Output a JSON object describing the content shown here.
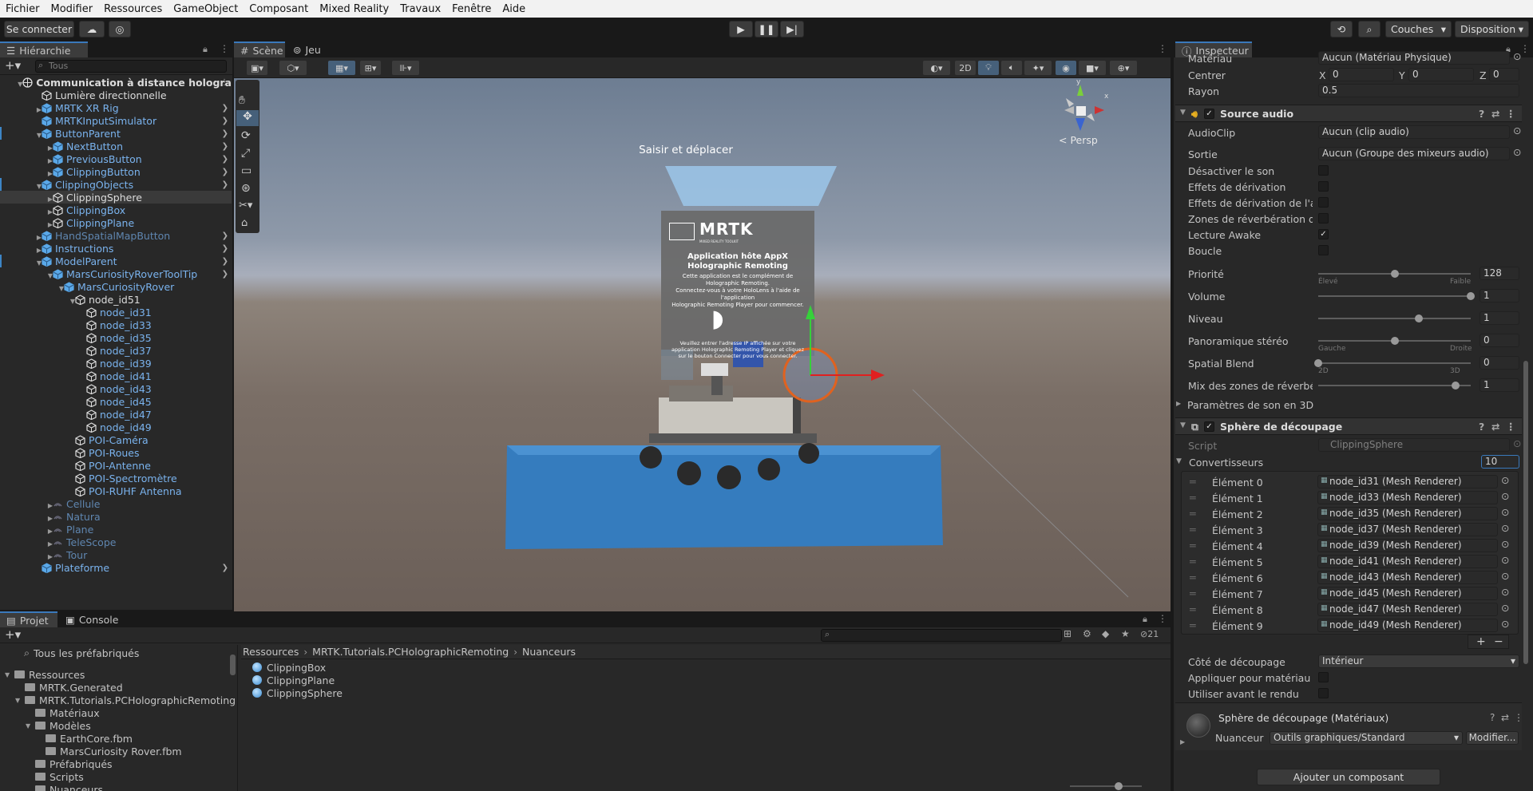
{
  "menu": [
    "Fichier",
    "Modifier",
    "Ressources",
    "GameObject",
    "Composant",
    "Mixed Reality",
    "Travaux",
    "Fenêtre",
    "Aide"
  ],
  "toolbar": {
    "connect": "Se connecter",
    "layers": "Couches",
    "layout": "Disposition"
  },
  "hierarchy": {
    "tab": "Hiérarchie",
    "search_placeholder": "Tous",
    "rows": [
      {
        "label": "Communication à distance hologra",
        "indent": 0,
        "tri": "▼",
        "style": "white",
        "icon": "scene"
      },
      {
        "label": "Lumière directionnelle",
        "indent": 1,
        "tri": "",
        "style": "white",
        "icon": "cube"
      },
      {
        "label": "MRTK XR Rig",
        "indent": 1,
        "tri": "▶",
        "style": "blue",
        "icon": "prefab",
        "chev": true
      },
      {
        "label": "MRTKInputSimulator",
        "indent": 1,
        "tri": "",
        "style": "blue",
        "icon": "prefab",
        "chev": true
      },
      {
        "label": "ButtonParent",
        "indent": 1,
        "tri": "▼",
        "style": "blue",
        "icon": "prefab",
        "chev": true,
        "mark": true
      },
      {
        "label": "NextButton",
        "indent": 2,
        "tri": "▶",
        "style": "blue",
        "icon": "prefab",
        "chev": true
      },
      {
        "label": "PreviousButton",
        "indent": 2,
        "tri": "▶",
        "style": "blue",
        "icon": "prefab",
        "chev": true
      },
      {
        "label": "ClippingButton",
        "indent": 2,
        "tri": "▶",
        "style": "blue",
        "icon": "prefab",
        "chev": true
      },
      {
        "label": "ClippingObjects",
        "indent": 1,
        "tri": "▼",
        "style": "blue",
        "icon": "prefab",
        "chev": true,
        "mark": true
      },
      {
        "label": "ClippingSphere",
        "indent": 2,
        "tri": "▶",
        "style": "white",
        "icon": "cube",
        "sel": true
      },
      {
        "label": "ClippingBox",
        "indent": 2,
        "tri": "▶",
        "style": "blue",
        "icon": "cube"
      },
      {
        "label": "ClippingPlane",
        "indent": 2,
        "tri": "▶",
        "style": "blue",
        "icon": "cube"
      },
      {
        "label": "HandSpatialMapButton",
        "indent": 1,
        "tri": "▶",
        "style": "dim",
        "icon": "prefab",
        "chev": true
      },
      {
        "label": "Instructions",
        "indent": 1,
        "tri": "▶",
        "style": "blue",
        "icon": "prefab",
        "chev": true
      },
      {
        "label": "ModelParent",
        "indent": 1,
        "tri": "▼",
        "style": "blue",
        "icon": "prefab",
        "chev": true,
        "mark": true
      },
      {
        "label": "MarsCuriosityRoverToolTip",
        "indent": 2,
        "tri": "▼",
        "style": "blue",
        "icon": "prefab",
        "chev": true
      },
      {
        "label": "MarsCuriosityRover",
        "indent": 3,
        "tri": "▼",
        "style": "blue",
        "icon": "prefab"
      },
      {
        "label": "node_id51",
        "indent": 4,
        "tri": "▼",
        "style": "white",
        "icon": "cube"
      },
      {
        "label": "node_id31",
        "indent": 5,
        "tri": "",
        "style": "blue",
        "icon": "cube"
      },
      {
        "label": "node_id33",
        "indent": 5,
        "tri": "",
        "style": "blue",
        "icon": "cube"
      },
      {
        "label": "node_id35",
        "indent": 5,
        "tri": "",
        "style": "blue",
        "icon": "cube"
      },
      {
        "label": "node_id37",
        "indent": 5,
        "tri": "",
        "style": "blue",
        "icon": "cube"
      },
      {
        "label": "node_id39",
        "indent": 5,
        "tri": "",
        "style": "blue",
        "icon": "cube"
      },
      {
        "label": "node_id41",
        "indent": 5,
        "tri": "",
        "style": "blue",
        "icon": "cube"
      },
      {
        "label": "node_id43",
        "indent": 5,
        "tri": "",
        "style": "blue",
        "icon": "cube"
      },
      {
        "label": "node_id45",
        "indent": 5,
        "tri": "",
        "style": "blue",
        "icon": "cube"
      },
      {
        "label": "node_id47",
        "indent": 5,
        "tri": "",
        "style": "blue",
        "icon": "cube"
      },
      {
        "label": "node_id49",
        "indent": 5,
        "tri": "",
        "style": "blue",
        "icon": "cube"
      },
      {
        "label": "POI-Caméra",
        "indent": 4,
        "tri": "",
        "style": "blue",
        "icon": "cube"
      },
      {
        "label": "POI-Roues",
        "indent": 4,
        "tri": "",
        "style": "blue",
        "icon": "cube"
      },
      {
        "label": "POI-Antenne",
        "indent": 4,
        "tri": "",
        "style": "blue",
        "icon": "cube"
      },
      {
        "label": "POI-Spectromètre",
        "indent": 4,
        "tri": "",
        "style": "blue",
        "icon": "cube"
      },
      {
        "label": "POI-RUHF Antenna",
        "indent": 4,
        "tri": "",
        "style": "blue",
        "icon": "cube"
      },
      {
        "label": "Cellule",
        "indent": 2,
        "tri": "▶",
        "style": "dim",
        "icon": "hidden"
      },
      {
        "label": "Natura",
        "indent": 2,
        "tri": "▶",
        "style": "dim",
        "icon": "hidden"
      },
      {
        "label": "Plane",
        "indent": 2,
        "tri": "▶",
        "style": "dim",
        "icon": "hidden"
      },
      {
        "label": "TeleScope",
        "indent": 2,
        "tri": "▶",
        "style": "dim",
        "icon": "hidden"
      },
      {
        "label": "Tour",
        "indent": 2,
        "tri": "▶",
        "style": "dim",
        "icon": "hidden"
      },
      {
        "label": "Plateforme",
        "indent": 1,
        "tri": "",
        "style": "blue",
        "icon": "prefab",
        "chev": true
      }
    ]
  },
  "scene_view": {
    "tab_scene": "Scène",
    "tab_game": "Jeu",
    "btn_2d": "2D",
    "persp": "< Persp",
    "grab_label": "Saisir et déplacer",
    "board": {
      "logo": "MRTK",
      "logo_sub": "MIXED REALITY TOOLKIT",
      "title1": "Application hôte AppX",
      "title2": "Holographic Remoting",
      "desc1": "Cette application est le complément de",
      "desc2": "Holographic Remoting.",
      "desc3": "Connectez-vous à votre HoloLens à l'aide de l'application",
      "desc4": "Holographic Remoting Player pour commencer.",
      "foot1": "Veuillez entrer l'adresse IP affichée sur votre",
      "foot2": "application Holographic Remoting Player et cliquez",
      "foot3": "sur le bouton Connecter pour vous connecter."
    }
  },
  "inspector": {
    "tab": "Inspecteur",
    "materiau_label": "Matériau",
    "materiau_value": "Aucun (Matériau Physique)",
    "centrer_label": "Centrer",
    "centrer": {
      "x": "0",
      "y": "0",
      "z": "0"
    },
    "rayon_label": "Rayon",
    "rayon_value": "0.5",
    "audio_title": "Source audio",
    "audioclip_label": "AudioClip",
    "audioclip_value": "Aucun (clip audio)",
    "sortie_label": "Sortie",
    "sortie_value": "Aucun (Groupe des mixeurs audio)",
    "checks": [
      {
        "label": "Désactiver le son",
        "checked": false
      },
      {
        "label": "Effets de dérivation",
        "checked": false
      },
      {
        "label": "Effets de dérivation de l'auc",
        "checked": false
      },
      {
        "label": "Zones de réverbération de",
        "checked": false
      },
      {
        "label": "Lecture Awake",
        "checked": true
      },
      {
        "label": "Boucle",
        "checked": false
      }
    ],
    "sliders": [
      {
        "label": "Priorité",
        "value": "128",
        "pos": 0.5,
        "left_hint": "Élevé",
        "right_hint": "Faible"
      },
      {
        "label": "Volume",
        "value": "1",
        "pos": 1.0
      },
      {
        "label": "Niveau",
        "value": "1",
        "pos": 0.66
      },
      {
        "label": "Panoramique stéréo",
        "value": "0",
        "pos": 0.5,
        "left_hint": "Gauche",
        "right_hint": "Droite"
      },
      {
        "label": "Spatial Blend",
        "value": "0",
        "pos": 0.0,
        "left_hint": "2D",
        "right_hint": "3D"
      },
      {
        "label": "Mix des zones de réverbéra",
        "value": "1",
        "pos": 0.9
      }
    ],
    "sound3d_label": "Paramètres de son en 3D",
    "sphere_title": "Sphère de découpage",
    "script_label": "Script",
    "script_value": "ClippingSphere",
    "convert_label": "Convertisseurs",
    "convert_count": "10",
    "elements": [
      {
        "label": "Élément 0",
        "value": "node_id31 (Mesh Renderer)"
      },
      {
        "label": "Élément 1",
        "value": "node_id33 (Mesh Renderer)"
      },
      {
        "label": "Élément 2",
        "value": "node_id35 (Mesh Renderer)"
      },
      {
        "label": "Élément 3",
        "value": "node_id37 (Mesh Renderer)"
      },
      {
        "label": "Élément 4",
        "value": "node_id39 (Mesh Renderer)"
      },
      {
        "label": "Élément 5",
        "value": "node_id41 (Mesh Renderer)"
      },
      {
        "label": "Élément 6",
        "value": "node_id43 (Mesh Renderer)"
      },
      {
        "label": "Élément 7",
        "value": "node_id45 (Mesh Renderer)"
      },
      {
        "label": "Élément 8",
        "value": "node_id47 (Mesh Renderer)"
      },
      {
        "label": "Élément 9",
        "value": "node_id49 (Mesh Renderer)"
      }
    ],
    "cote_label": "Côté de découpage",
    "cote_value": "Intérieur",
    "appliquer_label": "Appliquer pour matériau par",
    "utiliser_label": "Utiliser avant le rendu",
    "mat_title": "Sphère de découpage (Matériaux)",
    "nuanceur_label": "Nuanceur",
    "nuanceur_value": "Outils graphiques/Standard",
    "modifier_btn": "Modifier...",
    "add_component": "Ajouter un composant"
  },
  "project": {
    "tab_project": "Projet",
    "tab_console": "Console",
    "favorites": "Tous les préfabriqués",
    "badge": "21",
    "breadcrumb": [
      "Ressources",
      "MRTK.Tutorials.PCHolographicRemoting",
      "Nuanceurs"
    ],
    "tree": [
      {
        "label": "Ressources",
        "indent": 0,
        "tri": "▼"
      },
      {
        "label": "MRTK.Generated",
        "indent": 1,
        "tri": ""
      },
      {
        "label": "MRTK.Tutorials.PCHolographicRemoting",
        "indent": 1,
        "tri": "▼"
      },
      {
        "label": "Matériaux",
        "indent": 2,
        "tri": ""
      },
      {
        "label": "Modèles",
        "indent": 2,
        "tri": "▼"
      },
      {
        "label": "EarthCore.fbm",
        "indent": 3,
        "tri": ""
      },
      {
        "label": "MarsCuriosity Rover.fbm",
        "indent": 3,
        "tri": ""
      },
      {
        "label": "Préfabriqués",
        "indent": 2,
        "tri": ""
      },
      {
        "label": "Scripts",
        "indent": 2,
        "tri": ""
      },
      {
        "label": "Nuanceurs",
        "indent": 2,
        "tri": ""
      }
    ],
    "assets": [
      "ClippingBox",
      "ClippingPlane",
      "ClippingSphere"
    ]
  }
}
